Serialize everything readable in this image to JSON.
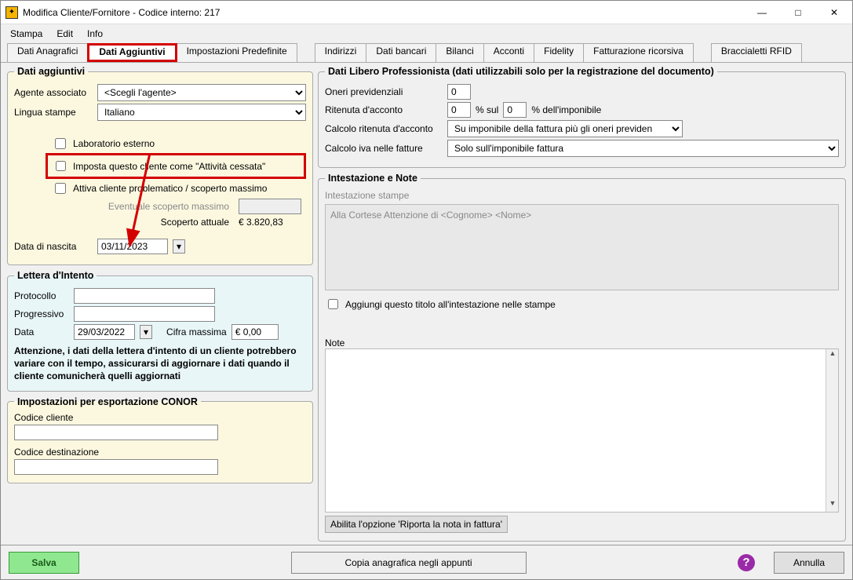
{
  "window": {
    "title": "Modifica Cliente/Fornitore - Codice interno: 217"
  },
  "menu": {
    "stampa": "Stampa",
    "edit": "Edit",
    "info": "Info"
  },
  "tabs": {
    "anagrafici": "Dati Anagrafici",
    "aggiuntivi": "Dati Aggiuntivi",
    "impostazioni": "Impostazioni Predefinite",
    "indirizzi": "Indirizzi",
    "bancari": "Dati bancari",
    "bilanci": "Bilanci",
    "acconti": "Acconti",
    "fidelity": "Fidelity",
    "fatturazione": "Fatturazione ricorsiva",
    "rfid": "Braccialetti RFID"
  },
  "datiAgg": {
    "legend": "Dati aggiuntivi",
    "agente_label": "Agente associato",
    "agente_value": "<Scegli l'agente>",
    "lingua_label": "Lingua stampe",
    "lingua_value": "Italiano",
    "lab_esterno": "Laboratorio esterno",
    "attivita_cessata": "Imposta questo cliente come \"Attività cessata\"",
    "cliente_problem": "Attiva cliente problematico / scoperto massimo",
    "eventuale_label": "Eventuale scoperto massimo",
    "scoperto_label": "Scoperto attuale",
    "scoperto_value": "€ 3.820,83",
    "nascita_label": "Data di nascita",
    "nascita_value": "03/11/2023"
  },
  "lettera": {
    "legend": "Lettera d'Intento",
    "protocollo": "Protocollo",
    "progressivo": "Progressivo",
    "data_label": "Data",
    "data_value": "29/03/2022",
    "cifra_label": "Cifra massima",
    "cifra_value": "€ 0,00",
    "warning": "Attenzione, i dati della lettera d'intento di un cliente potrebbero variare con il tempo, assicurarsi di aggiornare i dati quando il cliente comunicherà quelli aggiornati"
  },
  "conor": {
    "legend": "Impostazioni per esportazione CONOR",
    "codice_cliente": "Codice cliente",
    "codice_dest": "Codice destinazione"
  },
  "libero": {
    "legend": "Dati Libero Professionista (dati utilizzabili solo per la registrazione del documento)",
    "oneri_label": "Oneri previdenziali",
    "oneri_value": "0",
    "ritenuta_label": "Ritenuta d'acconto",
    "ritenuta_value": "0",
    "sul_label": "% sul",
    "sul_value": "0",
    "imponibile_label": "% dell'imponibile",
    "calc_rit_label": "Calcolo ritenuta d'acconto",
    "calc_rit_value": "Su imponibile della fattura più gli oneri previden",
    "calc_iva_label": "Calcolo iva nelle fatture",
    "calc_iva_value": "Solo sull'imponibile fattura"
  },
  "intest": {
    "legend": "Intestazione e Note",
    "stampe_label": "Intestazione stampe",
    "stampe_text": "Alla Cortese Attenzione di <Cognome> <Nome>",
    "aggiungi": "Aggiungi questo titolo all'intestazione nelle stampe",
    "note_label": "Note",
    "abilita_btn": "Abilita l'opzione 'Riporta la nota in fattura'"
  },
  "footer": {
    "salva": "Salva",
    "copia": "Copia anagrafica negli appunti",
    "annulla": "Annulla"
  }
}
